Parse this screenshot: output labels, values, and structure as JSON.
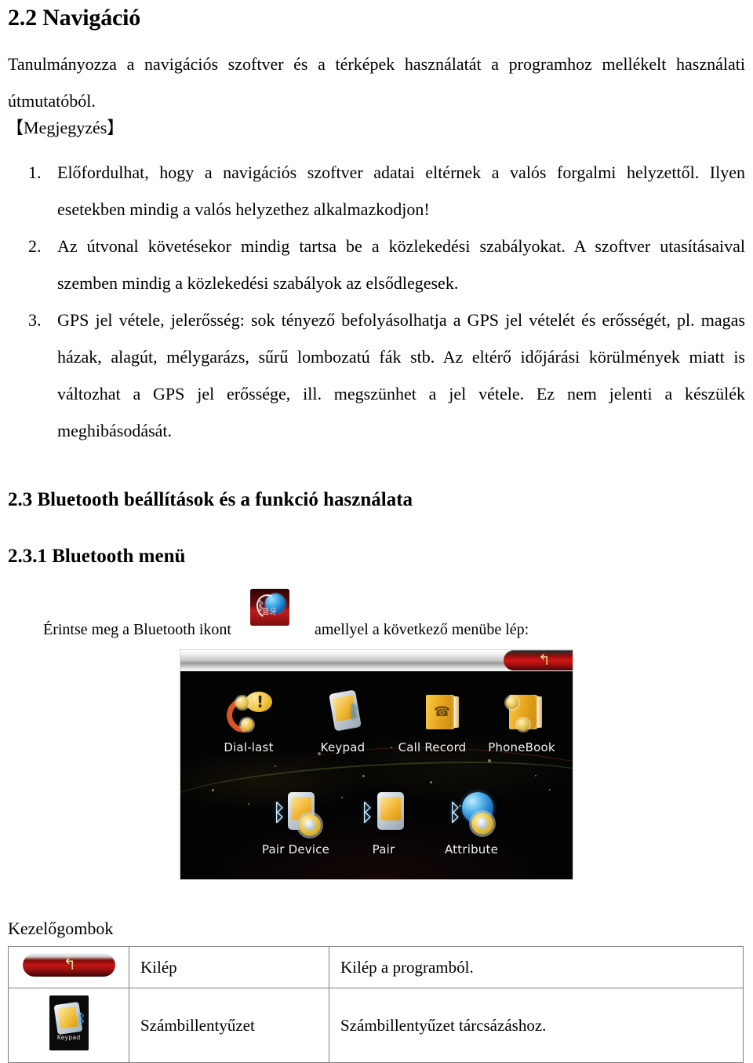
{
  "headings": {
    "nav_section": "2.2 Navigáció",
    "bt_section": "2.3 Bluetooth beállítások és a funkció használata",
    "bt_subsection": "2.3.1 Bluetooth menü"
  },
  "intro": {
    "paragraph": "Tanulmányozza a navigációs szoftver és a térképek használatát a programhoz mellékelt használati útmutatóból.",
    "note_marker": "【Megjegyzés】"
  },
  "notes": [
    {
      "number": "1.",
      "text": "Előfordulhat, hogy a navigációs szoftver adatai eltérnek a valós forgalmi helyzettől. Ilyen esetekben mindig a valós helyzethez alkalmazkodjon!"
    },
    {
      "number": "2.",
      "text": "Az útvonal követésekor mindig tartsa be a közlekedési szabályokat. A szoftver utasításaival szemben mindig a közlekedési szabályok az elsődlegesek."
    },
    {
      "number": "3.",
      "text": "GPS jel vétele, jelerősség: sok tényező befolyásolhatja a GPS jel vételét és erősségét, pl. magas házak, alagút, mélygarázs, sűrű lombozatú fák stb. Az eltérő időjárási körülmények miatt is változhat a GPS jel erőssége, ill. megszünhet a jel vétele. Ez nem jelenti a készülék meghibásodását."
    }
  ],
  "touch_instruction": {
    "before_icon": "Érintse meg a Bluetooth ikont",
    "after_icon": "amellyel a következő menübe lép:",
    "icon_name": "bluetooth-globe-headset-icon",
    "icon_caption": "蓝牙"
  },
  "device_screenshot": {
    "back_button_glyph": "↰",
    "apps": [
      {
        "label": "Dial-last",
        "icon": "dial-last-icon"
      },
      {
        "label": "Keypad",
        "icon": "keypad-icon"
      },
      {
        "label": "Call Record",
        "icon": "call-record-icon"
      },
      {
        "label": "PhoneBook",
        "icon": "phonebook-icon"
      },
      {
        "label": "Pair Device",
        "icon": "pair-device-icon"
      },
      {
        "label": "Pair",
        "icon": "pair-icon"
      },
      {
        "label": "Attribute",
        "icon": "attribute-icon"
      }
    ]
  },
  "buttons_table": {
    "caption": "Kezelőgombok",
    "rows": [
      {
        "icon": "exit-back-button-icon",
        "name": "Kilép",
        "description": "Kilép a programból."
      },
      {
        "icon": "keypad-button-icon",
        "icon_label": "Keypad",
        "name": "Számbillentyűzet",
        "description": "Számbillentyűzet tárcsázáshoz."
      }
    ]
  },
  "colors": {
    "accent_red": "#c81414",
    "arrow_gold": "#f3d98f",
    "table_border": "#808080",
    "device_bg": "#030303"
  }
}
